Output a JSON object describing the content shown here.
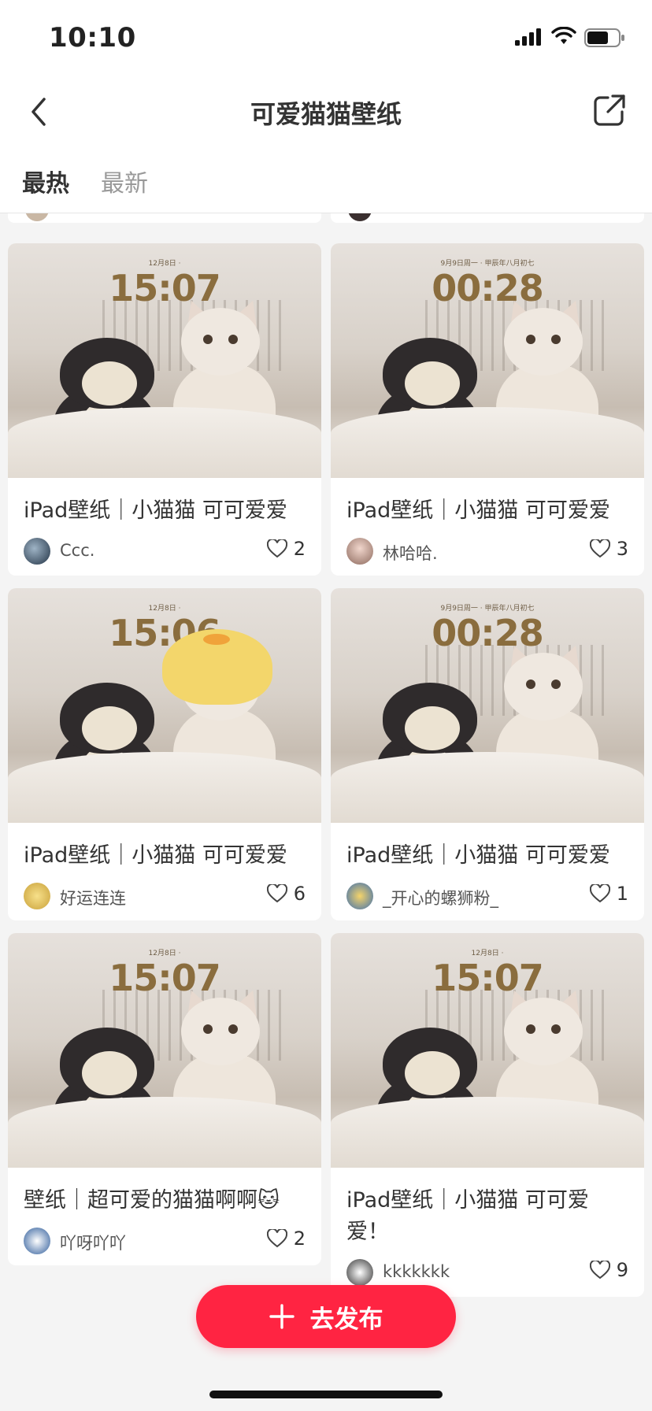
{
  "status_bar": {
    "time": "10:10"
  },
  "header": {
    "title": "可爱猫猫壁纸",
    "back_icon": "chevron-left-icon",
    "share_icon": "share-icon"
  },
  "tabs": [
    {
      "label": "最热",
      "active": true
    },
    {
      "label": "最新",
      "active": false
    }
  ],
  "cards": [
    {
      "title": "iPad壁纸｜小猫猫 可可爱爱",
      "author": "Ccc.",
      "likes": "2",
      "clock": "15:07",
      "date_line": "12月8日 ·"
    },
    {
      "title": "iPad壁纸｜小猫猫 可可爱爱",
      "author": "林哈哈.",
      "likes": "3",
      "clock": "00:28",
      "date_line": "9月9日周一 · 甲辰年八月初七"
    },
    {
      "title": "iPad壁纸｜小猫猫 可可爱爱",
      "author": "好运连连",
      "likes": "6",
      "clock": "15:06",
      "date_line": "12月8日 ·"
    },
    {
      "title": "iPad壁纸｜小猫猫 可可爱爱",
      "author": "_开心的螺狮粉_",
      "likes": "1",
      "clock": "00:28",
      "date_line": "9月9日周一 · 甲辰年八月初七"
    },
    {
      "title": "壁纸｜超可爱的猫猫啊啊🐱",
      "author": "吖呀吖吖",
      "likes": "2",
      "clock": "15:07",
      "date_line": "12月8日 ·"
    },
    {
      "title": "iPad壁纸｜小猫猫 可可爱爱！",
      "author": "kkkkkkk",
      "likes": "9",
      "clock": "15:07",
      "date_line": "12月8日 ·"
    }
  ],
  "publish_button": {
    "label": "去发布",
    "icon": "plus-icon"
  },
  "colors": {
    "accent": "#ff2442",
    "clock_gold": "#8a6d3e"
  }
}
